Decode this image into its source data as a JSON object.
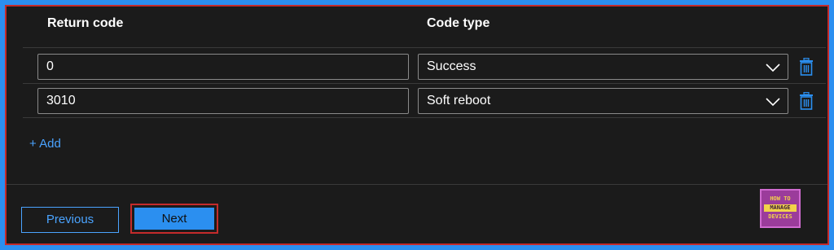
{
  "table": {
    "col_return_code": "Return code",
    "col_code_type": "Code type",
    "rows": [
      {
        "return_code": "0",
        "code_type": "Success"
      },
      {
        "return_code": "3010",
        "code_type": "Soft reboot"
      }
    ]
  },
  "actions": {
    "add_label": "+ Add",
    "previous_label": "Previous",
    "next_label": "Next"
  },
  "logo": {
    "line1": "HOW TO",
    "line2": "MANAGE",
    "line3": "DEVICES"
  },
  "icons": {
    "dropdown": "chevron-down-icon",
    "delete": "trash-icon"
  },
  "colors": {
    "accent": "#2b8ff0",
    "highlight_border": "#c42b2b",
    "link": "#4aa3ff",
    "background": "#1b1b1b"
  }
}
